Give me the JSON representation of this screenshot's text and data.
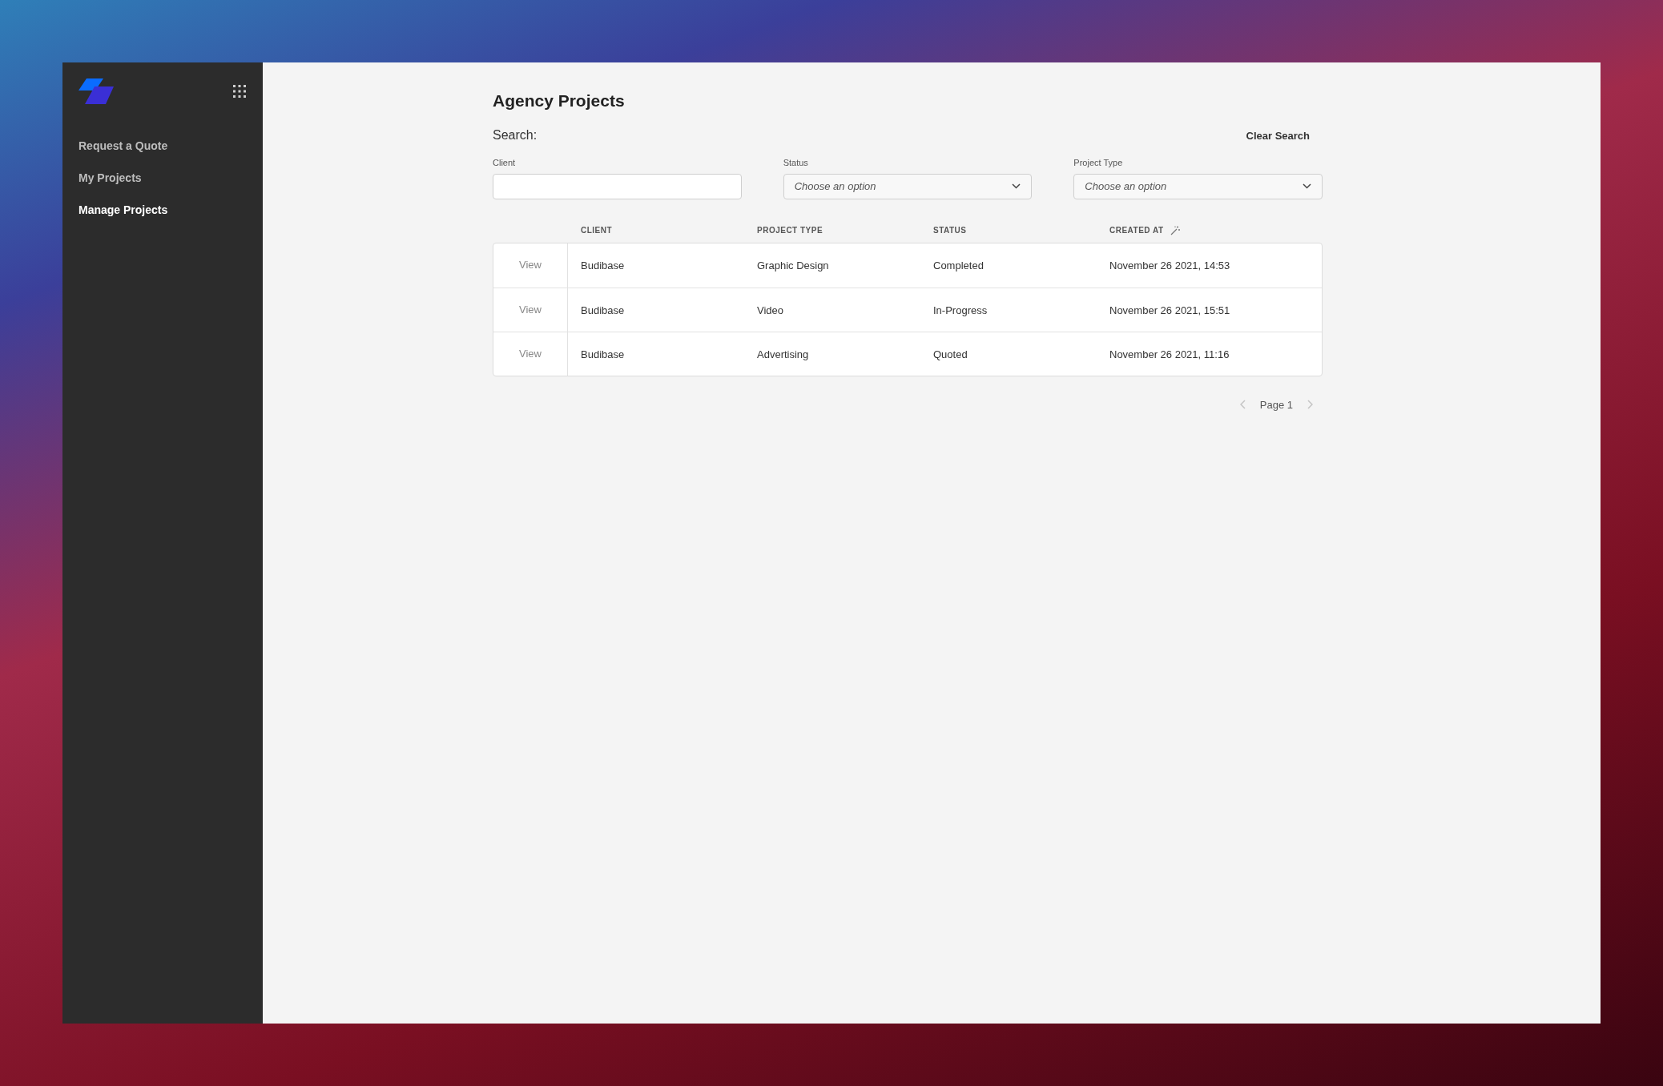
{
  "sidebar": {
    "items": [
      {
        "label": "Request a Quote",
        "selected": false
      },
      {
        "label": "My Projects",
        "selected": false
      },
      {
        "label": "Manage Projects",
        "selected": true
      }
    ]
  },
  "page": {
    "title": "Agency Projects",
    "search_label": "Search:",
    "clear_button": "Clear Search"
  },
  "filters": [
    {
      "kind": "text",
      "label": "Client"
    },
    {
      "kind": "select",
      "label": "Status",
      "placeholder": "Choose an option"
    },
    {
      "kind": "select",
      "label": "Project Type",
      "placeholder": "Choose an option"
    }
  ],
  "table": {
    "columns": [
      "CLIENT",
      "PROJECT TYPE",
      "STATUS",
      "CREATED AT"
    ],
    "rows": [
      {
        "action": "View",
        "cells": [
          "Budibase",
          "Graphic Design",
          "Completed",
          "November 26 2021, 14:53"
        ]
      },
      {
        "action": "View",
        "cells": [
          "Budibase",
          "Video",
          "In-Progress",
          "November 26 2021, 15:51"
        ]
      },
      {
        "action": "View",
        "cells": [
          "Budibase",
          "Advertising",
          "Quoted",
          "November 26 2021, 11:16"
        ]
      }
    ]
  },
  "pagination": {
    "label": "Page 1"
  }
}
